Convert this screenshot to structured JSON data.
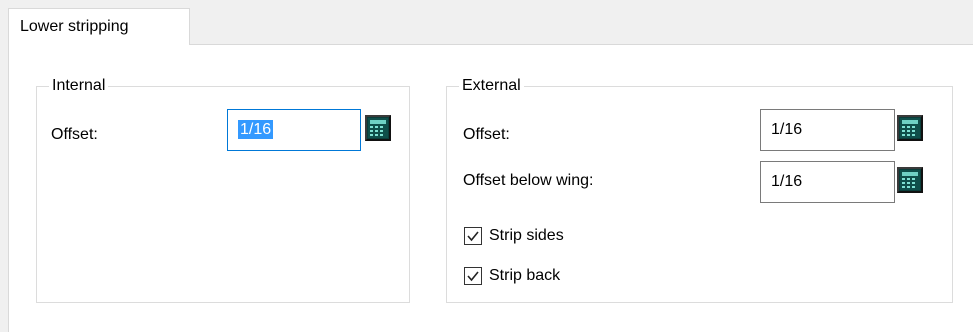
{
  "tab": {
    "label": "Lower stripping"
  },
  "internal": {
    "title": "Internal",
    "offset_label": "Offset:",
    "offset_value": "1/16"
  },
  "external": {
    "title": "External",
    "offset_label": "Offset:",
    "offset_value": "1/16",
    "offset_below_wing_label": "Offset below wing:",
    "offset_below_wing_value": "1/16",
    "strip_sides_label": "Strip sides",
    "strip_sides_checked": true,
    "strip_back_label": "Strip back",
    "strip_back_checked": true
  },
  "icons": {
    "calculator": "calculator-icon",
    "checkmark": "checkmark-icon"
  }
}
